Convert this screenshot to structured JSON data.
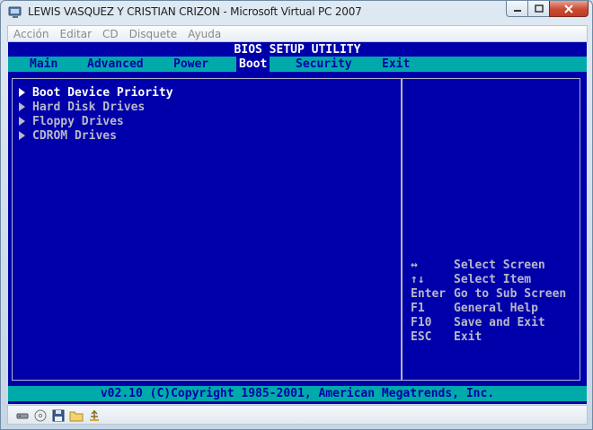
{
  "window": {
    "title": "LEWIS VASQUEZ Y CRISTIAN CRIZON - Microsoft Virtual PC 2007"
  },
  "menu": [
    "Acción",
    "Editar",
    "CD",
    "Disquete",
    "Ayuda"
  ],
  "bios": {
    "header": "BIOS SETUP UTILITY",
    "tabs": [
      "Main",
      "Advanced",
      "Power",
      "Boot",
      "Security",
      "Exit"
    ],
    "active_tab": "Boot",
    "items": [
      "Boot Device Priority",
      "Hard Disk Drives",
      "Floppy Drives",
      "CDROM Drives"
    ],
    "help": [
      {
        "key": "↔",
        "desc": "Select Screen"
      },
      {
        "key": "↑↓",
        "desc": "Select Item"
      },
      {
        "key": "Enter",
        "desc": "Go to Sub Screen"
      },
      {
        "key": "F1",
        "desc": "General Help"
      },
      {
        "key": "F10",
        "desc": "Save and Exit"
      },
      {
        "key": "ESC",
        "desc": "Exit"
      }
    ],
    "footer": "v02.10 (C)Copyright 1985-2001, American Megatrends, Inc.",
    "colors": {
      "background": "#0000aa",
      "bar": "#00aaaa",
      "text": "#b8b8c8",
      "highlight": "#ffffff"
    }
  },
  "statusbar": {
    "icons": [
      "network-icon",
      "cd-drive-icon",
      "floppy-icon",
      "shared-folder-icon",
      "usb-icon"
    ]
  }
}
